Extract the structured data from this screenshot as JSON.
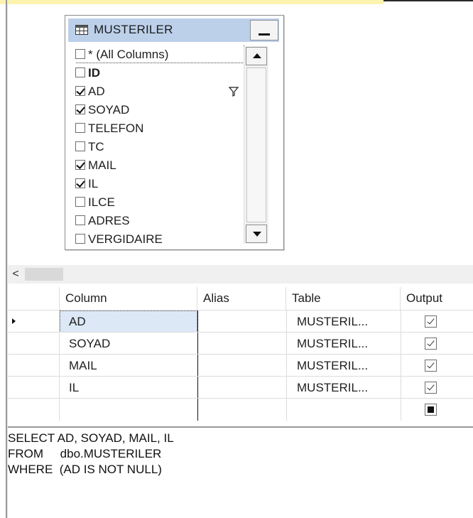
{
  "table_widget": {
    "title": "MUSTERILER",
    "columns": [
      {
        "label": "* (All Columns)",
        "checked": false,
        "bold": false
      },
      {
        "label": "ID",
        "checked": false,
        "bold": true
      },
      {
        "label": "AD",
        "checked": true,
        "bold": false,
        "filter": true
      },
      {
        "label": "SOYAD",
        "checked": true,
        "bold": false
      },
      {
        "label": "TELEFON",
        "checked": false,
        "bold": false
      },
      {
        "label": "TC",
        "checked": false,
        "bold": false
      },
      {
        "label": "MAIL",
        "checked": true,
        "bold": false
      },
      {
        "label": "IL",
        "checked": true,
        "bold": false
      },
      {
        "label": "ILCE",
        "checked": false,
        "bold": false
      },
      {
        "label": "ADRES",
        "checked": false,
        "bold": false
      },
      {
        "label": "VERGIDAIRE",
        "checked": false,
        "bold": false
      }
    ]
  },
  "hscroll": {
    "left_label": "<"
  },
  "grid": {
    "headers": {
      "column": "Column",
      "alias": "Alias",
      "table": "Table",
      "output": "Output"
    },
    "rows": [
      {
        "column": "AD",
        "alias": "",
        "table": "MUSTERIL...",
        "output": "checked"
      },
      {
        "column": "SOYAD",
        "alias": "",
        "table": "MUSTERIL...",
        "output": "checked"
      },
      {
        "column": "MAIL",
        "alias": "",
        "table": "MUSTERIL...",
        "output": "checked"
      },
      {
        "column": "IL",
        "alias": "",
        "table": "MUSTERIL...",
        "output": "checked"
      },
      {
        "column": "",
        "alias": "",
        "table": "",
        "output": "indeterminate"
      }
    ]
  },
  "sql": {
    "line1": "SELECT AD, SOYAD, MAIL, IL",
    "line2": "FROM     dbo.MUSTERILER",
    "line3": "WHERE  (AD IS NOT NULL)"
  },
  "colors": {
    "header_bg": "#bcd0ea",
    "accent": "#fdf3b0",
    "selected_cell": "#dce8f6"
  }
}
